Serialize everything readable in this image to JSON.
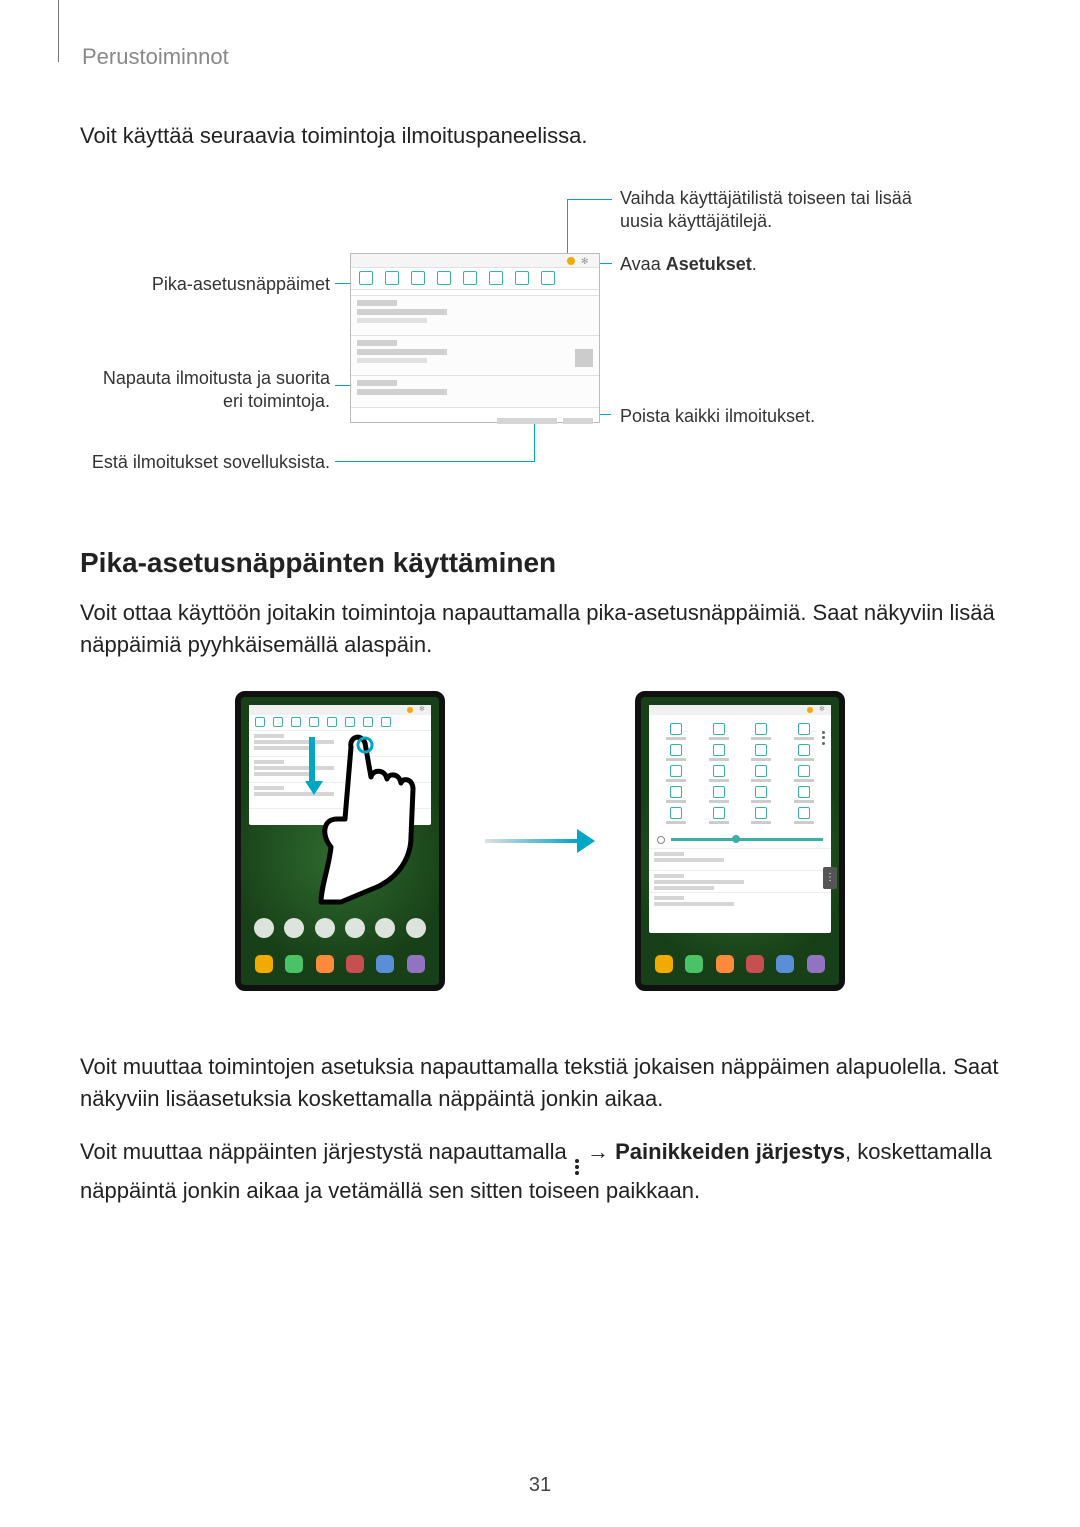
{
  "header": "Perustoiminnot",
  "intro": "Voit käyttää seuraavia toimintoja ilmoituspaneelissa.",
  "callouts": {
    "quick_settings": "Pika-asetusnäppäimet",
    "tap_notification": "Napauta ilmoitusta ja suorita eri toimintoja.",
    "block_notifications": "Estä ilmoitukset sovelluksista.",
    "switch_account": "Vaihda käyttäjätilistä toiseen tai lisää uusia käyttäjätilejä.",
    "open_settings_prefix": "Avaa ",
    "open_settings_bold": "Asetukset",
    "open_settings_suffix": ".",
    "clear_notifications": "Poista kaikki ilmoitukset."
  },
  "h2": "Pika-asetusnäppäinten käyttäminen",
  "para1": "Voit ottaa käyttöön joitakin toimintoja napauttamalla pika-asetusnäppäimiä. Saat näkyviin lisää näppäimiä pyyhkäisemällä alaspäin.",
  "para2": "Voit muuttaa toimintojen asetuksia napauttamalla tekstiä jokaisen näppäimen alapuolella. Saat näkyviin lisäasetuksia koskettamalla näppäintä jonkin aikaa.",
  "para3_a": "Voit muuttaa näppäinten järjestystä napauttamalla ",
  "para3_arrow": " → ",
  "para3_bold": "Painikkeiden järjestys",
  "para3_b": ", koskettamalla näppäintä jonkin aikaa ja vetämällä sen sitten toiseen paikkaan.",
  "pageno": "31"
}
